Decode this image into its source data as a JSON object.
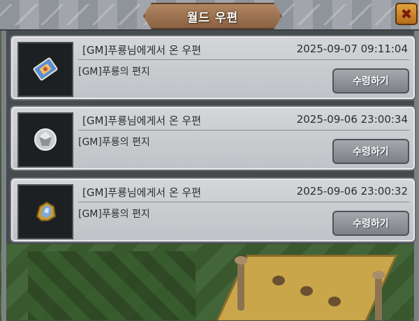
{
  "header": {
    "title": "월드 우편",
    "close_icon": "close-icon"
  },
  "mails": [
    {
      "icon": "scroll-ticket-icon",
      "sender": "[GM]푸룡님에게서 온 우편",
      "date": "2025-09-07 09:11:04",
      "body": "[GM]푸룡의 편지",
      "claim_label": "수령하기"
    },
    {
      "icon": "silver-gem-icon",
      "sender": "[GM]푸룡님에게서 온 우편",
      "date": "2025-09-06 23:00:34",
      "body": "[GM]푸룡의 편지",
      "claim_label": "수령하기"
    },
    {
      "icon": "blue-ore-icon",
      "sender": "[GM]푸룡님에게서 온 우편",
      "date": "2025-09-06 23:00:32",
      "body": "[GM]푸룡의 편지",
      "claim_label": "수령하기"
    }
  ]
}
